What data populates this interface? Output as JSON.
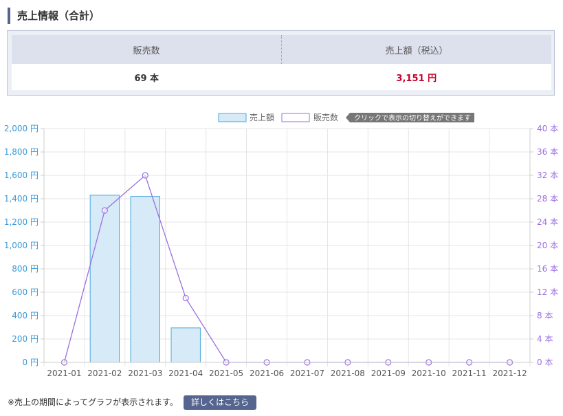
{
  "section": {
    "title": "売上情報（合計）"
  },
  "summary": {
    "headers": [
      "販売数",
      "売上額（税込）"
    ],
    "quantity": "69 本",
    "amount": "3,151 円"
  },
  "legend": {
    "sales_label": "売上額",
    "count_label": "販売数",
    "hint": "クリックで表示の切り替えができます"
  },
  "colors": {
    "bar_fill": "#d6eaf8",
    "bar_stroke": "#4aa8de",
    "line": "#9b6fe0",
    "left_axis": "#3a9ad9",
    "right_axis": "#9b6fe0",
    "amount": "#c8002a",
    "accent": "#56658f"
  },
  "chart_data": {
    "type": "bar",
    "categories": [
      "2021-01",
      "2021-02",
      "2021-03",
      "2021-04",
      "2021-05",
      "2021-06",
      "2021-07",
      "2021-08",
      "2021-09",
      "2021-10",
      "2021-11",
      "2021-12"
    ],
    "series": [
      {
        "name": "売上額",
        "type": "bar",
        "axis": "left",
        "values": [
          0,
          1430,
          1420,
          295,
          0,
          0,
          0,
          0,
          0,
          0,
          0,
          0
        ]
      },
      {
        "name": "販売数",
        "type": "line",
        "axis": "right",
        "values": [
          0,
          26,
          32,
          11,
          0,
          0,
          0,
          0,
          0,
          0,
          0,
          0
        ]
      }
    ],
    "y_left": {
      "min": 0,
      "max": 2000,
      "ticks": [
        "0 円",
        "200 円",
        "400 円",
        "600 円",
        "800 円",
        "1,000 円",
        "1,200 円",
        "1,400 円",
        "1,600 円",
        "1,800 円",
        "2,000 円"
      ]
    },
    "y_right": {
      "min": 0,
      "max": 40,
      "ticks": [
        "0 本",
        "4 本",
        "8 本",
        "12 本",
        "16 本",
        "20 本",
        "24 本",
        "28 本",
        "32 本",
        "36 本",
        "40 本"
      ]
    },
    "grid": true,
    "legend_position": "top"
  },
  "footer": {
    "note": "※売上の期間によってグラフが表示されます。",
    "button": "詳しくはこちら"
  }
}
